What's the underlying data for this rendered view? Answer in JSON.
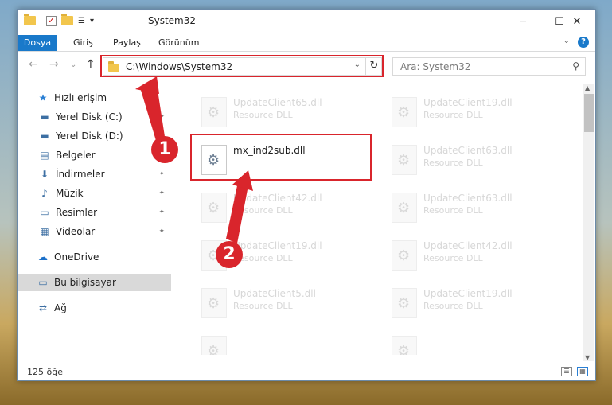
{
  "window": {
    "title": "System32",
    "minimize": "─",
    "maximize": "☐",
    "close": "✕"
  },
  "qat": {
    "check": "✓",
    "dropdown": "▾"
  },
  "menu": {
    "file": "Dosya",
    "home": "Giriş",
    "share": "Paylaş",
    "view": "Görünüm",
    "expand": "⌄",
    "help": "?"
  },
  "nav": {
    "back": "←",
    "forward": "→",
    "recent": "⌄",
    "up": "↑",
    "address": "C:\\Windows\\System32",
    "address_dropdown": "⌄",
    "refresh": "↻",
    "search_placeholder": "Ara: System32",
    "search_icon": "⚲"
  },
  "sidebar": {
    "items": [
      {
        "label": "Hızlı erişim",
        "icon": "★",
        "icon_name": "star-icon",
        "pinned": false
      },
      {
        "label": "Yerel Disk (C:)",
        "icon": "▬",
        "icon_name": "drive-icon",
        "pinned": true
      },
      {
        "label": "Yerel Disk (D:)",
        "icon": "▬",
        "icon_name": "drive-icon",
        "pinned": true
      },
      {
        "label": "Belgeler",
        "icon": "▤",
        "icon_name": "documents-icon",
        "pinned": true
      },
      {
        "label": "İndirmeler",
        "icon": "⬇",
        "icon_name": "downloads-icon",
        "pinned": true
      },
      {
        "label": "Müzik",
        "icon": "♪",
        "icon_name": "music-icon",
        "pinned": true
      },
      {
        "label": "Resimler",
        "icon": "▭",
        "icon_name": "pictures-icon",
        "pinned": true
      },
      {
        "label": "Videolar",
        "icon": "▦",
        "icon_name": "videos-icon",
        "pinned": true
      },
      {
        "label": "OneDrive",
        "icon": "☁",
        "icon_name": "cloud-icon",
        "pinned": false
      },
      {
        "label": "Bu bilgisayar",
        "icon": "▭",
        "icon_name": "computer-icon",
        "pinned": false,
        "selected": true
      },
      {
        "label": "Ağ",
        "icon": "⇄",
        "icon_name": "network-icon",
        "pinned": false
      }
    ],
    "pin_glyph": "✦"
  },
  "files": {
    "left": [
      {
        "name": "UpdateClient65.dll",
        "type": "Resource DLL",
        "faded": true
      },
      {
        "name": "mx_ind2sub.dll",
        "type": "",
        "faded": false,
        "highlighted": true
      },
      {
        "name": "UpdateClient42.dll",
        "type": "Resource DLL",
        "faded": true
      },
      {
        "name": "UpdateClient19.dll",
        "type": "Resource DLL",
        "faded": true
      },
      {
        "name": "UpdateClient5.dll",
        "type": "Resource DLL",
        "faded": true
      },
      {
        "name": "",
        "type": "",
        "faded": true
      }
    ],
    "right": [
      {
        "name": "UpdateClient19.dll",
        "type": "Resource DLL",
        "faded": true
      },
      {
        "name": "UpdateClient63.dll",
        "type": "Resource DLL",
        "faded": true
      },
      {
        "name": "UpdateClient63.dll",
        "type": "Resource DLL",
        "faded": true
      },
      {
        "name": "UpdateClient42.dll",
        "type": "Resource DLL",
        "faded": true
      },
      {
        "name": "UpdateClient19.dll",
        "type": "Resource DLL",
        "faded": true
      },
      {
        "name": "",
        "type": "",
        "faded": true
      }
    ]
  },
  "status": {
    "count": "125 öğe",
    "details_view": "☰",
    "icons_view": "▦"
  },
  "callouts": {
    "one": "1",
    "two": "2"
  },
  "accent": {
    "file_tab": "#1979ca",
    "annotation": "#d9252c"
  }
}
